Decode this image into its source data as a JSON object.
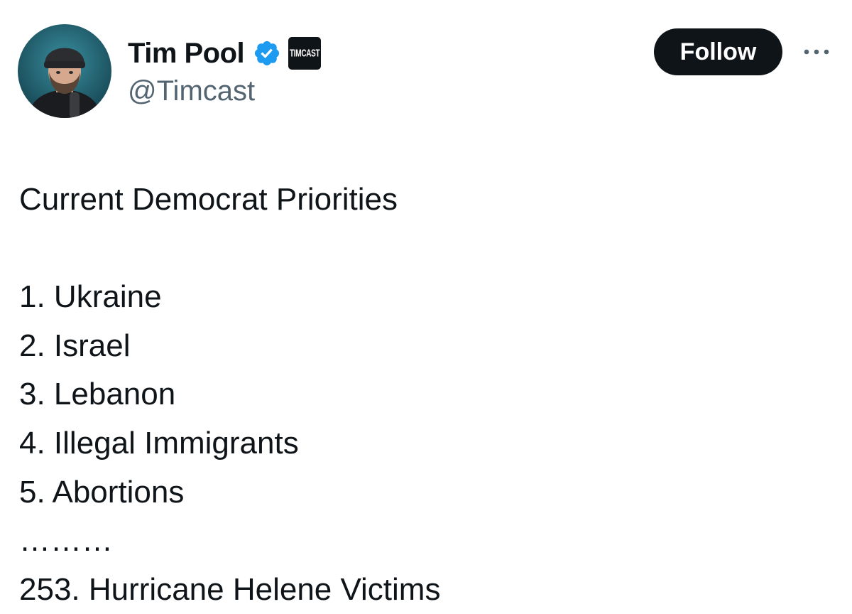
{
  "author": {
    "display_name": "Tim Pool",
    "handle": "@Timcast",
    "verified": true,
    "affiliate_badge_text": "TIMCAST"
  },
  "actions": {
    "follow_label": "Follow",
    "more_icon": "more-horizontal-icon"
  },
  "tweet": {
    "lines": [
      "Current Democrat Priorities",
      "",
      "1. Ukraine",
      "2. Israel",
      "3. Lebanon",
      "4. Illegal Immigrants",
      "5. Abortions",
      "………",
      "253. Hurricane Helene Victims"
    ]
  },
  "colors": {
    "text_primary": "#0f1419",
    "text_secondary": "#536471",
    "verified_blue": "#1d9bf0",
    "follow_bg": "#0f1419",
    "follow_text": "#ffffff"
  }
}
